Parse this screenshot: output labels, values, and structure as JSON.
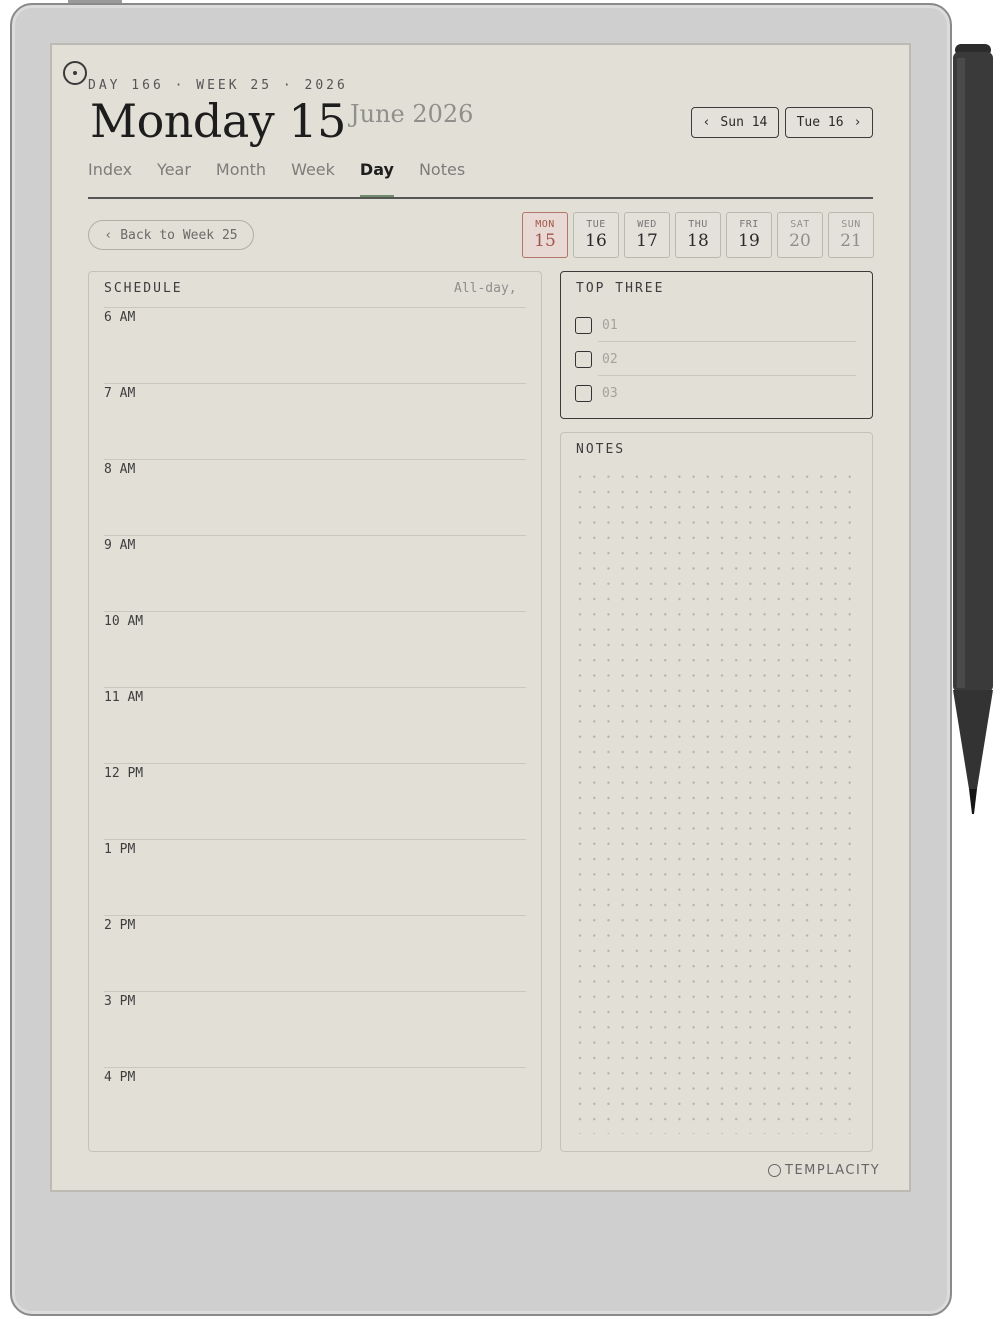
{
  "header": {
    "eyebrow": "DAY 166 · WEEK 25 · 2026",
    "title": "Monday 15",
    "subtitle": "June 2026",
    "prev_label": "Sun 14",
    "next_label": "Tue 16",
    "prev_chevron": "‹",
    "next_chevron": "›"
  },
  "tabs": [
    {
      "label": "Index"
    },
    {
      "label": "Year"
    },
    {
      "label": "Month"
    },
    {
      "label": "Week"
    },
    {
      "label": "Day",
      "active": true
    },
    {
      "label": "Notes"
    }
  ],
  "back_button": {
    "chevron": "‹",
    "label": "Back to Week 25"
  },
  "week_strip": [
    {
      "dow": "MON",
      "num": "15",
      "active": true
    },
    {
      "dow": "TUE",
      "num": "16"
    },
    {
      "dow": "WED",
      "num": "17"
    },
    {
      "dow": "THU",
      "num": "18"
    },
    {
      "dow": "FRI",
      "num": "19"
    },
    {
      "dow": "SAT",
      "num": "20",
      "weekend": true
    },
    {
      "dow": "SUN",
      "num": "21",
      "weekend": true
    }
  ],
  "schedule": {
    "title": "SCHEDULE",
    "all_day_label": "All-day,",
    "hours": [
      "6 AM",
      "7 AM",
      "8 AM",
      "9 AM",
      "10 AM",
      "11 AM",
      "12 PM",
      "1 PM",
      "2 PM",
      "3 PM",
      "4 PM"
    ]
  },
  "top_three": {
    "title": "TOP THREE",
    "items": [
      "01",
      "02",
      "03"
    ]
  },
  "notes": {
    "title": "NOTES"
  },
  "brand": "TEMPLACITY",
  "colors": {
    "paper": "#e2dfd7",
    "accent_active": "#a0564a",
    "tab_underline": "#6f8a6c"
  }
}
